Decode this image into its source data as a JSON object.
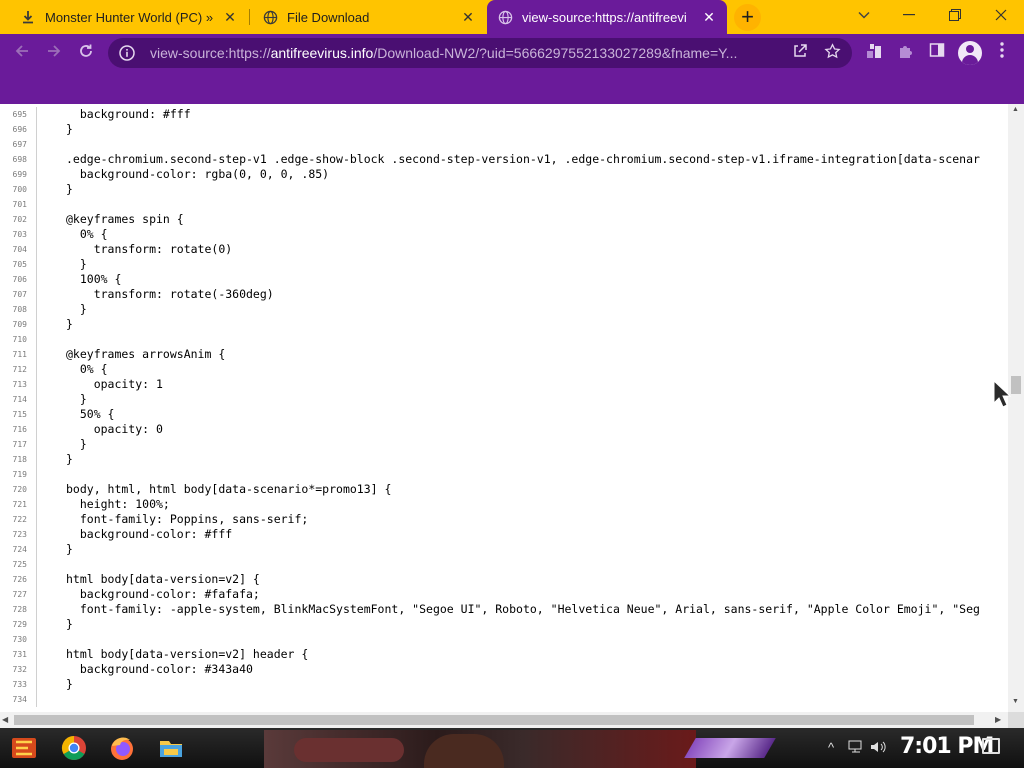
{
  "browser": {
    "tabs": [
      {
        "title": "Monster Hunter World (PC) » Ci",
        "icon": "download-icon",
        "active": false
      },
      {
        "title": "File Download",
        "icon": "globe-icon",
        "active": false
      },
      {
        "title": "view-source:https://antifreevi",
        "icon": "globe-icon",
        "active": true
      }
    ],
    "close_glyph": "✕",
    "new_tab_glyph": "+",
    "url_prefix": "view-source:https://",
    "url_domain": "antifreevirus.info",
    "url_rest": "/Download-NW2/?uid=5666297552133027289&fname=Y...",
    "colors": {
      "tab_strip": "#ffc400",
      "theme": "#6a1b9a"
    }
  },
  "source": {
    "lines": [
      {
        "n": "695",
        "code": "  background: #fff"
      },
      {
        "n": "696",
        "code": "}"
      },
      {
        "n": "697",
        "code": ""
      },
      {
        "n": "698",
        "code": ".edge-chromium.second-step-v1 .edge-show-block .second-step-version-v1, .edge-chromium.second-step-v1.iframe-integration[data-scenar"
      },
      {
        "n": "699",
        "code": "  background-color: rgba(0, 0, 0, .85)"
      },
      {
        "n": "700",
        "code": "}"
      },
      {
        "n": "701",
        "code": ""
      },
      {
        "n": "702",
        "code": "@keyframes spin {"
      },
      {
        "n": "703",
        "code": "  0% {"
      },
      {
        "n": "704",
        "code": "    transform: rotate(0)"
      },
      {
        "n": "705",
        "code": "  }"
      },
      {
        "n": "706",
        "code": "  100% {"
      },
      {
        "n": "707",
        "code": "    transform: rotate(-360deg)"
      },
      {
        "n": "708",
        "code": "  }"
      },
      {
        "n": "709",
        "code": "}"
      },
      {
        "n": "710",
        "code": ""
      },
      {
        "n": "711",
        "code": "@keyframes arrowsAnim {"
      },
      {
        "n": "712",
        "code": "  0% {"
      },
      {
        "n": "713",
        "code": "    opacity: 1"
      },
      {
        "n": "714",
        "code": "  }"
      },
      {
        "n": "715",
        "code": "  50% {"
      },
      {
        "n": "716",
        "code": "    opacity: 0"
      },
      {
        "n": "717",
        "code": "  }"
      },
      {
        "n": "718",
        "code": "}"
      },
      {
        "n": "719",
        "code": ""
      },
      {
        "n": "720",
        "code": "body, html, html body[data-scenario*=promo13] {"
      },
      {
        "n": "721",
        "code": "  height: 100%;"
      },
      {
        "n": "722",
        "code": "  font-family: Poppins, sans-serif;"
      },
      {
        "n": "723",
        "code": "  background-color: #fff"
      },
      {
        "n": "724",
        "code": "}"
      },
      {
        "n": "725",
        "code": ""
      },
      {
        "n": "726",
        "code": "html body[data-version=v2] {"
      },
      {
        "n": "727",
        "code": "  background-color: #fafafa;"
      },
      {
        "n": "728",
        "code": "  font-family: -apple-system, BlinkMacSystemFont, \"Segoe UI\", Roboto, \"Helvetica Neue\", Arial, sans-serif, \"Apple Color Emoji\", \"Seg"
      },
      {
        "n": "729",
        "code": "}"
      },
      {
        "n": "730",
        "code": ""
      },
      {
        "n": "731",
        "code": "html body[data-version=v2] header {"
      },
      {
        "n": "732",
        "code": "  background-color: #343a40"
      },
      {
        "n": "733",
        "code": "}"
      },
      {
        "n": "734",
        "code": ""
      }
    ]
  },
  "taskbar": {
    "clock": "7:01 PM",
    "pinned": [
      {
        "name": "start-button-icon"
      },
      {
        "name": "chrome-icon"
      },
      {
        "name": "firefox-icon"
      },
      {
        "name": "file-explorer-icon"
      }
    ]
  }
}
